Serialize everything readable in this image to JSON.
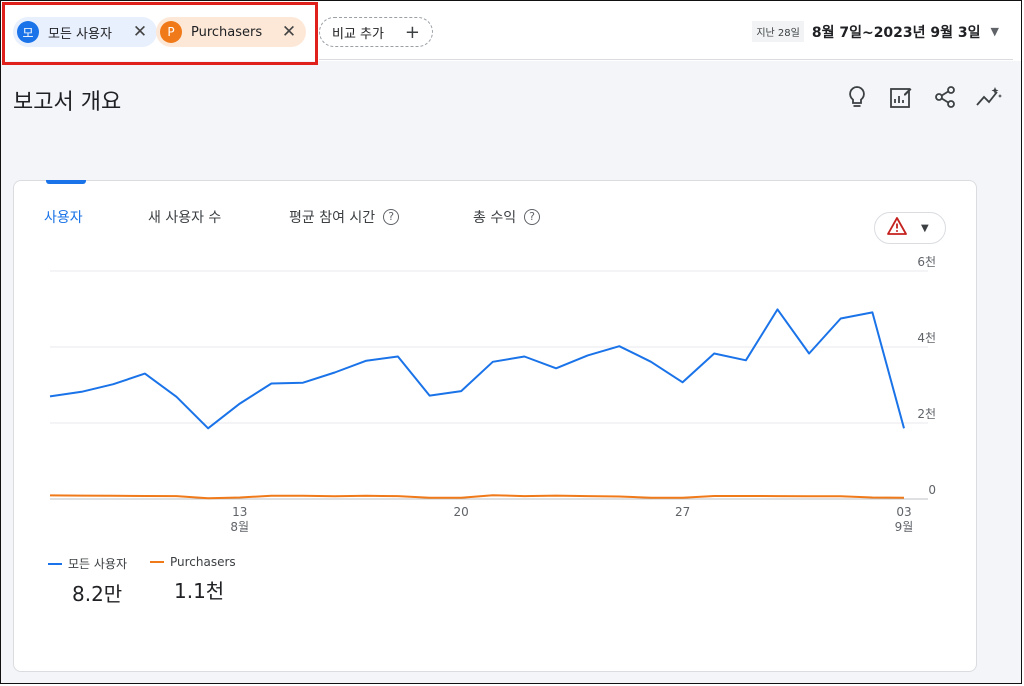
{
  "segments": [
    {
      "initial": "모",
      "label": "모든 사용자",
      "color": "#1a73e8"
    },
    {
      "initial": "P",
      "label": "Purchasers",
      "color": "#f07a19"
    }
  ],
  "add_compare_label": "비교 추가",
  "date_range": {
    "period": "지난 28일",
    "range": "8월 7일~2023년 9월 3일"
  },
  "page_title": "보고서 개요",
  "toolbar_icons": [
    "lightbulb-icon",
    "edit-report-icon",
    "share-icon",
    "insights-icon"
  ],
  "metric_tabs": [
    {
      "label": "사용자",
      "active": true,
      "help": false
    },
    {
      "label": "새 사용자 수",
      "active": false,
      "help": false
    },
    {
      "label": "평균 참여 시간",
      "active": false,
      "help": true
    },
    {
      "label": "총 수익",
      "active": false,
      "help": true
    }
  ],
  "colors": {
    "series_all": "#1a73e8",
    "series_purchasers": "#f07a19",
    "warning": "#c5221f"
  },
  "chart_data": {
    "type": "line",
    "y_ticks": [
      {
        "value": 0,
        "label": "0"
      },
      {
        "value": 2000,
        "label": "2천"
      },
      {
        "value": 4000,
        "label": "4천"
      },
      {
        "value": 6000,
        "label": "6천"
      }
    ],
    "ylim": [
      0,
      6000
    ],
    "x_ticks": [
      {
        "index": 6,
        "label": "13",
        "sublabel": "8월"
      },
      {
        "index": 13,
        "label": "20",
        "sublabel": ""
      },
      {
        "index": 20,
        "label": "27",
        "sublabel": ""
      },
      {
        "index": 27,
        "label": "03",
        "sublabel": "9월"
      }
    ],
    "grid": true,
    "legend_position": "bottom-left",
    "series": [
      {
        "name": "모든 사용자",
        "total": "8.2만",
        "values": [
          2700,
          2820,
          3020,
          3300,
          2690,
          1860,
          2510,
          3040,
          3060,
          3330,
          3640,
          3750,
          2720,
          2840,
          3610,
          3750,
          3440,
          3780,
          4020,
          3610,
          3070,
          3830,
          3650,
          4990,
          3830,
          4750,
          4910,
          1860
        ]
      },
      {
        "name": "Purchasers",
        "total": "1.1천",
        "values": [
          95,
          90,
          85,
          80,
          75,
          20,
          40,
          85,
          85,
          70,
          85,
          75,
          35,
          35,
          100,
          75,
          90,
          75,
          65,
          35,
          35,
          80,
          80,
          75,
          70,
          70,
          40,
          35
        ]
      }
    ]
  }
}
